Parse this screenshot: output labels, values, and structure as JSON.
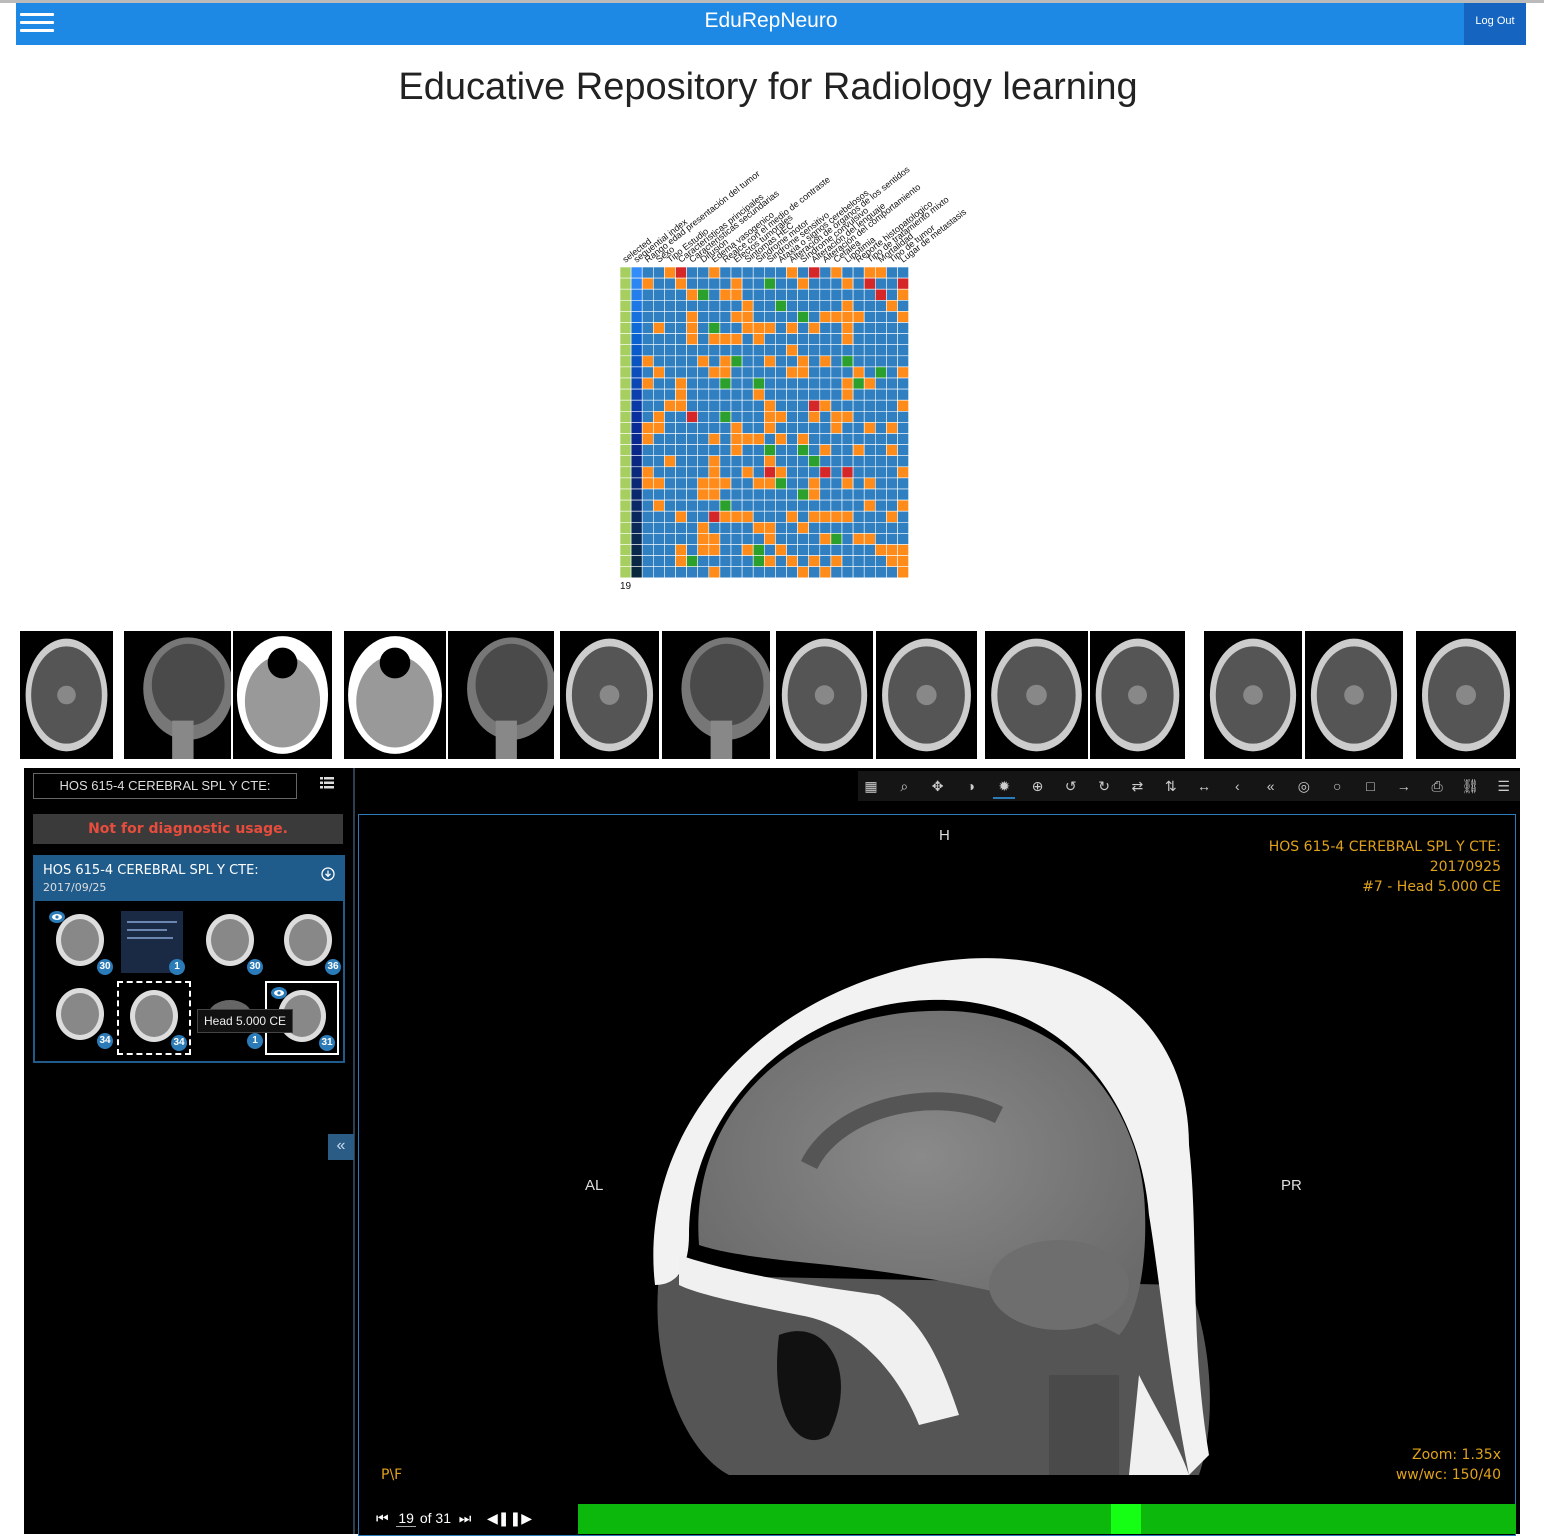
{
  "app": {
    "brand": "EduRepNeuro",
    "logout_label": "Log Out",
    "page_title": "Educative Repository for Radiology learning"
  },
  "heatmap": {
    "columns": [
      "selected",
      "sequential index",
      "Rango edad presentación del tumor",
      "Sexo",
      "Tipo Estudio",
      "Características principales",
      "Características secundarias",
      "Difusión",
      "Edema vasogenico",
      "Realce con el medio de contraste",
      "Efectos tumorales",
      "Sintomas HEC",
      "Sindrome motor",
      "Sindrome sensitivo",
      "Ataxia o signos cerebelosos",
      "Alteración de órganos de los sentidos",
      "Síndrome convulsivo",
      "Alteración del lenguaje",
      "Alteración del comportamiento",
      "Cefalea",
      "Lipotimia",
      "Reporte histopatologico",
      "Tipo de tratamiento mixto",
      "Mortalidad",
      "Tipo de tumor",
      "Lugar de metastasis"
    ],
    "footer_label": "19",
    "colors": {
      "blue": "#2f7fc1",
      "orange": "#ff8c1a",
      "green": "#2ca02c",
      "red": "#d62728",
      "lime": "#a6cf5f"
    }
  },
  "thumbnail_strip": {
    "count": 15
  },
  "viewer": {
    "study_select": "HOS 615-4 CEREBRAL SPL Y CTE:",
    "warning": "Not for diagnostic usage.",
    "study_card": {
      "title": "HOS 615-4 CEREBRAL SPL Y CTE:",
      "date": "2017/09/25",
      "series": [
        {
          "count": "30",
          "viewed": true,
          "kind": "sagittal"
        },
        {
          "count": "1",
          "viewed": false,
          "kind": "report"
        },
        {
          "count": "30",
          "viewed": false,
          "kind": "axial"
        },
        {
          "count": "36",
          "viewed": false,
          "kind": "coronal"
        },
        {
          "count": "34",
          "viewed": false,
          "kind": "coronal"
        },
        {
          "count": "34",
          "viewed": false,
          "kind": "axial",
          "selected": true
        },
        {
          "count": "1",
          "viewed": false,
          "kind": "scout"
        },
        {
          "count": "31",
          "viewed": true,
          "kind": "sagittal",
          "active": true
        }
      ],
      "tooltip": "Head 5.000 CE"
    },
    "collapse_label": "«",
    "toolbar_icons": [
      "grid-icon",
      "search-icon",
      "move-icon",
      "contrast-icon",
      "settings-icon",
      "zoom-in-icon",
      "rotate-left-icon",
      "rotate-right-icon",
      "swap-icon",
      "flip-vertical-icon",
      "flip-horizontal-icon",
      "chevron-left-icon",
      "double-chevron-left-icon",
      "target-icon",
      "circle-icon",
      "square-icon",
      "arrow-right-icon",
      "print-icon",
      "link-icon",
      "menu-icon"
    ],
    "overlay": {
      "top": "H",
      "left": "AL",
      "right": "PR",
      "bottom_left": "P\\F",
      "study": "HOS 615-4 CEREBRAL SPL Y CTE:",
      "date": "20170925",
      "series": "#7 - Head 5.000 CE",
      "zoom": "Zoom: 1.35x",
      "wwwc": "ww/wc: 150/40"
    },
    "frame": {
      "current": "19",
      "total_label": "of 31",
      "progress": 0.6
    }
  }
}
